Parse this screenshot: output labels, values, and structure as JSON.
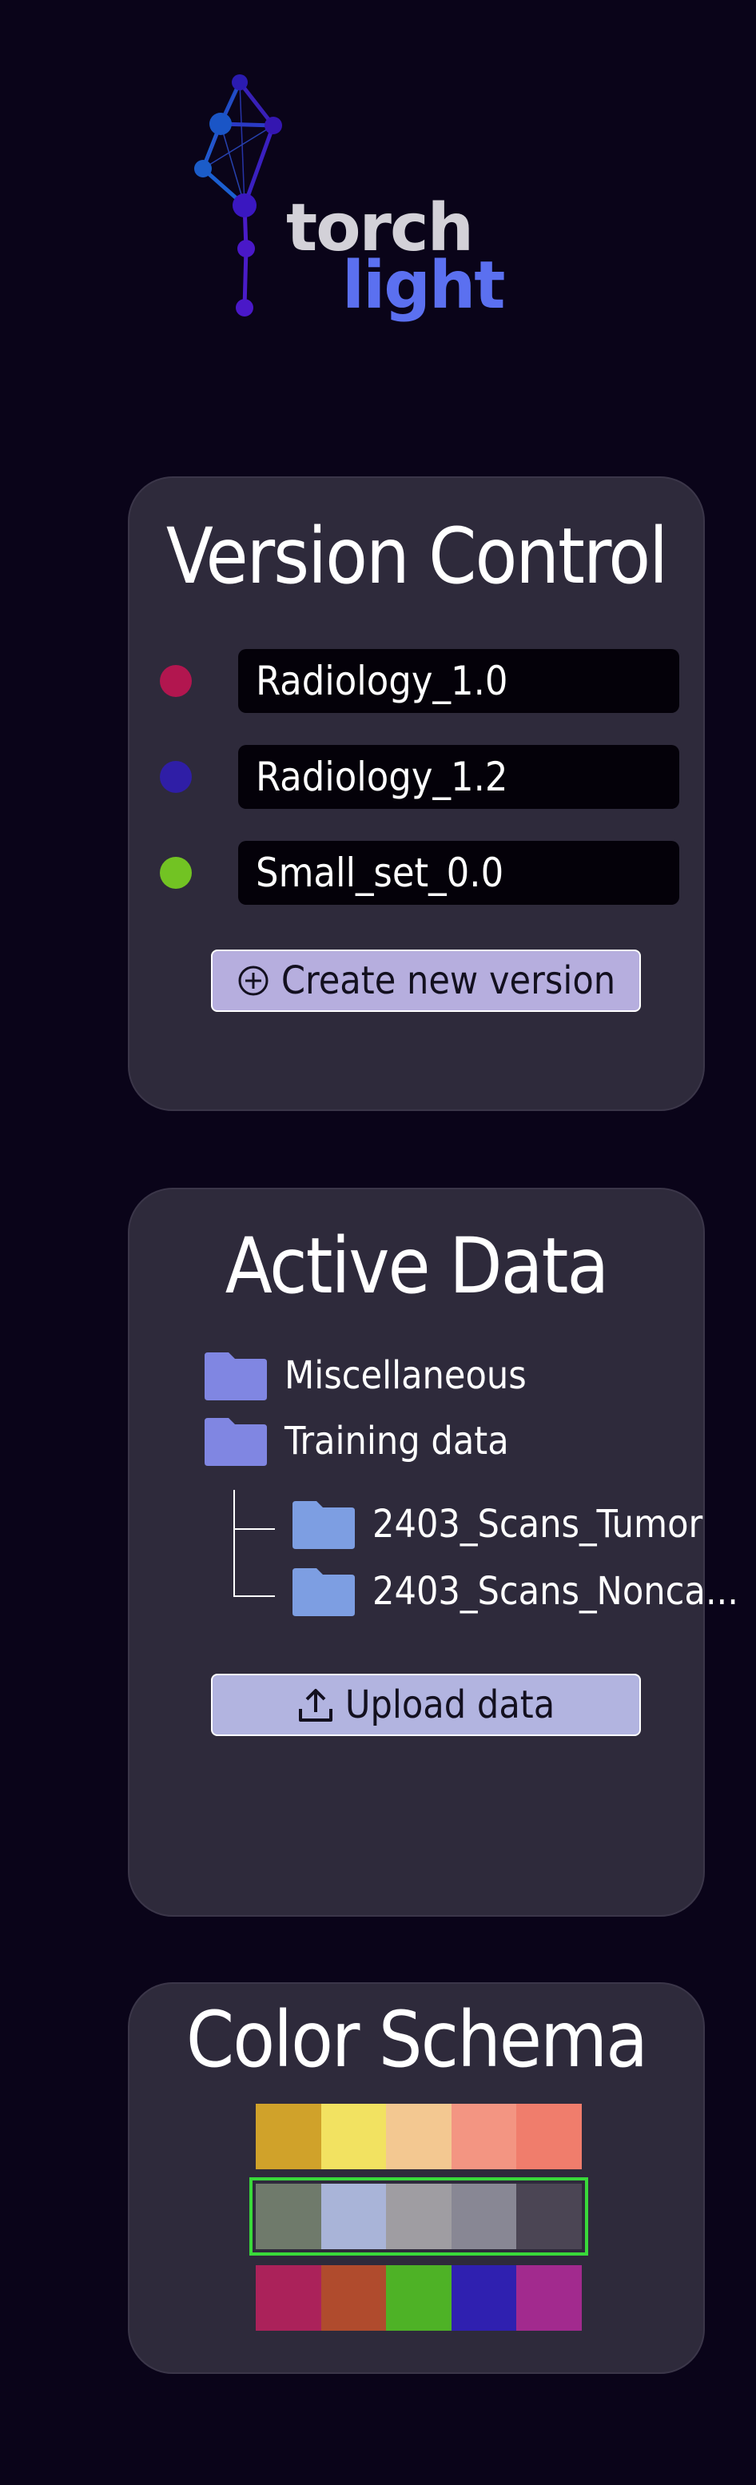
{
  "logo": {
    "word1": "torch",
    "word2": "light",
    "color_word1": "#d3d1d8",
    "color_word2": "#5b70f0"
  },
  "version_control": {
    "title": "Version Control",
    "versions": [
      {
        "label": "Radiology_1.0",
        "color": "#b2164f"
      },
      {
        "label": "Radiology_1.2",
        "color": "#2f1ea6"
      },
      {
        "label": "Small_set_0.0",
        "color": "#72c323"
      }
    ],
    "create_button": {
      "icon": "plus-circle-icon",
      "label": "Create new version"
    }
  },
  "active_data": {
    "title": "Active Data",
    "folders": [
      {
        "label": "Miscellaneous",
        "color": "#8086e2"
      },
      {
        "label": "Training data",
        "color": "#8086e2"
      }
    ],
    "subfolders": [
      {
        "label": "2403_Scans_Tumor",
        "color": "#7d9ee2"
      },
      {
        "label": "2403_Scans_Nonca...",
        "color": "#7d9ee2"
      }
    ],
    "upload_button": {
      "icon": "upload-icon",
      "label": "Upload data"
    }
  },
  "color_schema": {
    "title": "Color Schema",
    "palettes": [
      {
        "selected": false,
        "colors": [
          "#d0a22a",
          "#f2e261",
          "#f3c891",
          "#f39582",
          "#f07d6c"
        ]
      },
      {
        "selected": true,
        "colors": [
          "#6f7a6b",
          "#a9b4d8",
          "#9f9da2",
          "#888794",
          "#4b4554"
        ]
      },
      {
        "selected": false,
        "colors": [
          "#ab225a",
          "#b04b2d",
          "#4eb226",
          "#2f20b0",
          "#a22a8e"
        ]
      }
    ],
    "selected_outline_color": "#39d93a"
  }
}
